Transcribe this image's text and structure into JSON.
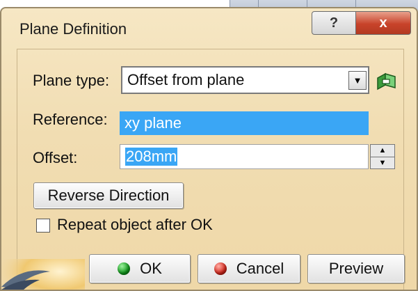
{
  "dialog": {
    "title": "Plane Definition",
    "help_label": "?",
    "close_label": "x"
  },
  "form": {
    "plane_type_label": "Plane type:",
    "plane_type_value": "Offset from plane",
    "reference_label": "Reference:",
    "reference_value": "xy plane",
    "offset_label": "Offset:",
    "offset_value": "208mm",
    "reverse_button": "Reverse Direction",
    "repeat_label": "Repeat object after OK",
    "repeat_checked": false
  },
  "buttons": {
    "ok": "OK",
    "cancel": "Cancel",
    "preview": "Preview"
  },
  "colors": {
    "dialog_bg": "#f1ddb2",
    "selection": "#3aa6f5",
    "close_red": "#c8432a"
  },
  "icons": [
    "help-icon",
    "close-icon",
    "dropdown-arrow-icon",
    "plane-icon",
    "spin-up-icon",
    "spin-down-icon",
    "ok-green-dot-icon",
    "cancel-red-dot-icon",
    "app-logo-icon"
  ]
}
